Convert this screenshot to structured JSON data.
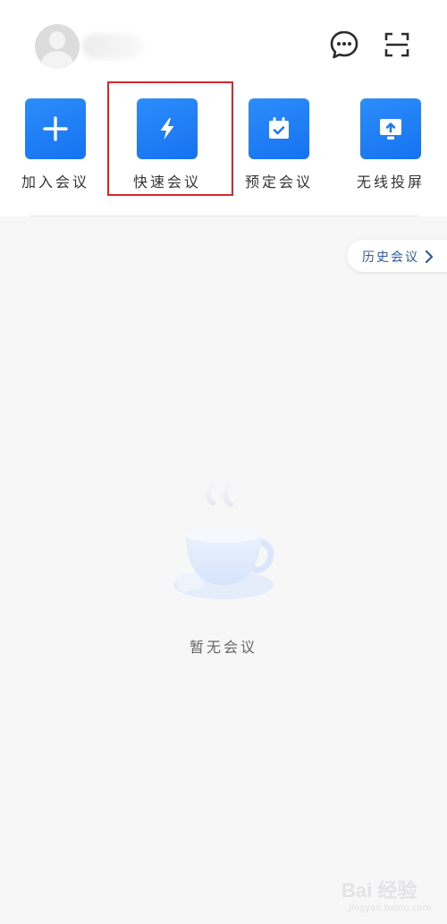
{
  "header": {
    "avatar": "avatar-placeholder",
    "icons": [
      "chat-bubble-icon",
      "scan-icon"
    ]
  },
  "quick_actions": [
    {
      "label": "加入会议",
      "icon": "plus-icon"
    },
    {
      "label": "快速会议",
      "icon": "lightning-icon"
    },
    {
      "label": "预定会议",
      "icon": "calendar-check-icon"
    },
    {
      "label": "无线投屏",
      "icon": "screen-cast-icon"
    }
  ],
  "history": {
    "label": "历史会议",
    "icon": "chevron-right-icon"
  },
  "empty_state": {
    "text": "暂无会议",
    "illustration": "coffee-cup"
  },
  "watermark": {
    "logo": "Bai 经验",
    "url": "jingyan.baidu.com"
  },
  "colors": {
    "accent": "#1a7af8",
    "highlight": "#d9262b",
    "history_text": "#2e5c9e",
    "background": "#f7f7f8"
  }
}
